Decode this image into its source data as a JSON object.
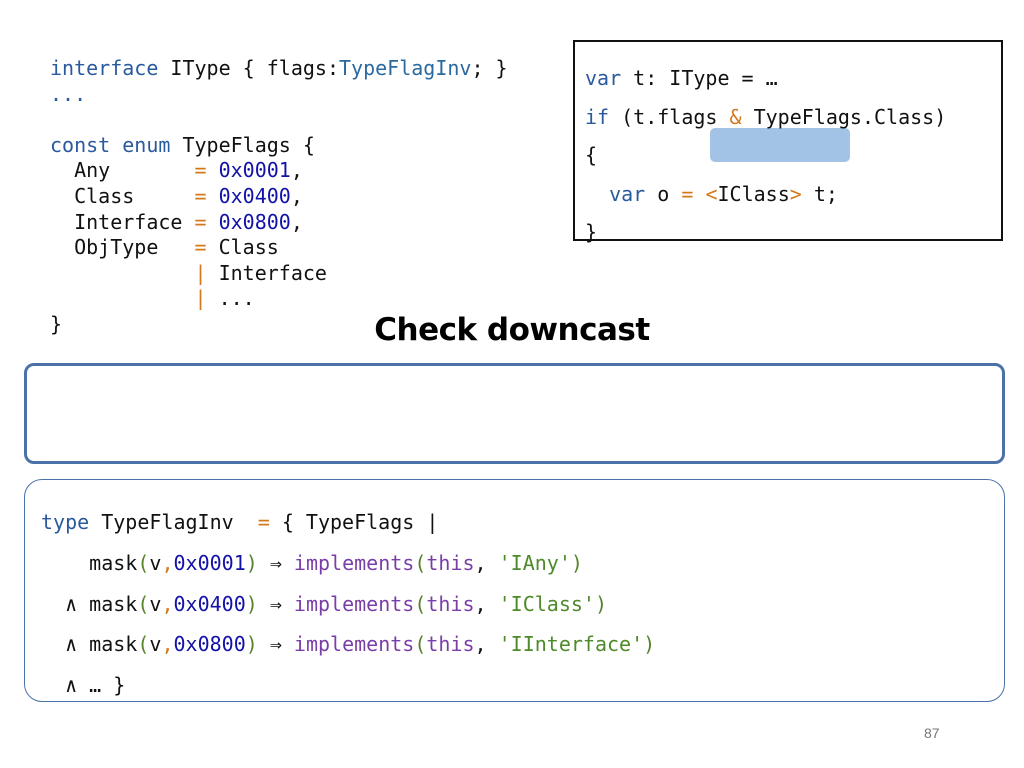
{
  "left_code": {
    "interface_kw": "interface",
    "itype_decl": " IType { flags:",
    "typeflaginv": "TypeFlagInv",
    "itype_end": "; }",
    "ellipsis": "...",
    "const_kw": "const",
    "enum_kw": "enum",
    "typeflags_open": " TypeFlags {",
    "entries": [
      {
        "name": "  Any       ",
        "op": "=",
        "value": "0x0001",
        "tail": ","
      },
      {
        "name": "  Class     ",
        "op": "=",
        "value": "0x0400",
        "tail": ","
      },
      {
        "name": "  Interface ",
        "op": "=",
        "value": "0x0800",
        "tail": ","
      }
    ],
    "objtype_name": "  ObjType   ",
    "objtype_op": "=",
    "objtype_value": " Class",
    "union_pad": "            ",
    "union_op": "|",
    "union_interface": " Interface",
    "union_rest": " ...",
    "close_brace": "}"
  },
  "right_code": {
    "var_kw": "var",
    "line1_rest": " t: IType = …",
    "if_kw": "if",
    "line2_a": " (t.flags ",
    "amp": "&",
    "line2_b": " TypeFlags.Class)",
    "open_brace": "{",
    "indent": "  ",
    "var_kw2": "var",
    "line4_a": " o ",
    "eq": "=",
    "space": " ",
    "lt": "<",
    "iclass": "IClass",
    "gt": ">",
    "line4_b": " t;",
    "close_brace": "}"
  },
  "title": "Check downcast",
  "bottom_code": {
    "type_kw": "type",
    "line1_a": " TypeFlagInv  ",
    "eq": "=",
    "line1_b": " { TypeFlags |",
    "rows": [
      {
        "prefix": "    ",
        "mask": "mask",
        "value": "0x0001",
        "iface": "'IAny'"
      },
      {
        "prefix": "  ∧ ",
        "mask": "mask",
        "value": "0x0400",
        "iface": "'IClass'"
      },
      {
        "prefix": "  ∧ ",
        "mask": "mask",
        "value": "0x0800",
        "iface": "'IInterface'"
      }
    ],
    "open_paren": "(",
    "v_comma_a": "v",
    "comma": ",",
    "close_paren": ")",
    "arrow": " ⇒ ",
    "implements": "implements",
    "this": "this",
    "comma_space": ", ",
    "last_line": "  ∧ … }"
  },
  "page_number": "87",
  "colors": {
    "keyword": "#2a5a9e",
    "operator": "#d4781e",
    "number": "#1212a8",
    "function": "#7a3ea8",
    "string": "#4f8a2a",
    "box_border": "#4a72a8",
    "highlight": "#a3c3e6"
  }
}
